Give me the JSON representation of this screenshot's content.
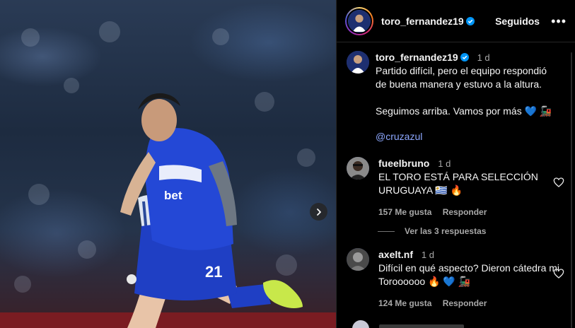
{
  "photo": {
    "jersey_number": "21",
    "sponsor_text": "bet",
    "next_icon": "chevron-right-icon"
  },
  "header": {
    "username": "toro_fernandez19",
    "follow_state": "Seguidos",
    "more_icon": "more-horizontal-icon"
  },
  "caption": {
    "username": "toro_fernandez19",
    "time": "1 d",
    "text": "Partido difícil, pero el equipo respondió de buena manera y estuvo a la altura.\n\nSeguimos arriba. Vamos por más 💙 🚂",
    "mention": "@cruzazul"
  },
  "comments": [
    {
      "username": "fueelbruno",
      "time": "1 d",
      "text": "EL TORO ESTÁ PARA SELECCIÓN URUGUAYA 🇺🇾 🔥",
      "likes": "157 Me gusta",
      "reply_label": "Responder"
    },
    {
      "username": "axelt.nf",
      "time": "1 d",
      "text": "Difícil en qué aspecto? Dieron cátedra mi Toroooooo 🔥 💙 🚂",
      "likes": "124 Me gusta",
      "reply_label": "Responder"
    }
  ],
  "replies_toggle": "Ver las 3 respuestas",
  "colors": {
    "background": "#000000",
    "mention": "#8da8ff",
    "muted": "#a8a8a8",
    "verified": "#0095f6",
    "jersey": "#1f3fc4"
  }
}
